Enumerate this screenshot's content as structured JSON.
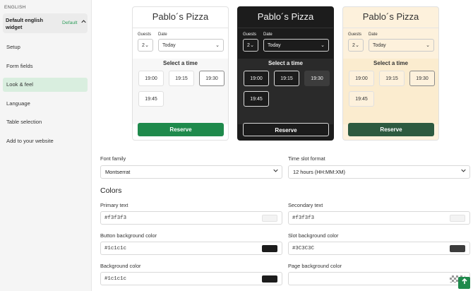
{
  "sidebar": {
    "language_heading": "ENGLISH",
    "widget_name": "Default english widget",
    "widget_badge": "Default",
    "items": [
      {
        "label": "Setup"
      },
      {
        "label": "Form fields"
      },
      {
        "label": "Look & feel"
      },
      {
        "label": "Language"
      },
      {
        "label": "Table selection"
      },
      {
        "label": "Add to your website"
      }
    ],
    "active_item": "Look & feel"
  },
  "previews": [
    {
      "theme": "light",
      "title": "Pablo´s Pizza",
      "guests_label": "Guests",
      "date_label": "Date",
      "guests_value": "2",
      "date_value": "Today",
      "slots_title": "Select a time",
      "slots": [
        "19:00",
        "19:15",
        "19:30",
        "19:45"
      ],
      "selected_slot": "19:30",
      "reserve_label": "Reserve",
      "colors": {
        "bg": "#ffffff",
        "text": "#333333",
        "slot_bg": "#ffffff",
        "button": "#1f8a4c"
      }
    },
    {
      "theme": "dark",
      "title": "Pablo´s Pizza",
      "guests_label": "Guests",
      "date_label": "Date",
      "guests_value": "2",
      "date_value": "Today",
      "slots_title": "Select a time",
      "slots": [
        "19:00",
        "19:15",
        "19:30",
        "19:45"
      ],
      "selected_slot": "19:30",
      "reserve_label": "Reserve",
      "colors": {
        "bg": "#1c1c1c",
        "text": "#f3f3f3",
        "slot_bg": "#1c1c1c",
        "button": "#1c1c1c"
      }
    },
    {
      "theme": "cream",
      "title": "Pablo´s Pizza",
      "guests_label": "Guests",
      "date_label": "Date",
      "guests_value": "2",
      "date_value": "Today",
      "slots_title": "Select a time",
      "slots": [
        "19:00",
        "19:15",
        "19:30",
        "19:45"
      ],
      "selected_slot": "19:30",
      "reserve_label": "Reserve",
      "colors": {
        "bg": "#fdf1dc",
        "text": "#333333",
        "slot_bg": "#fdf1dc",
        "button": "#2d5a40"
      }
    }
  ],
  "settings": {
    "font_family_label": "Font family",
    "font_family_value": "Montserrat",
    "time_format_label": "Time slot format",
    "time_format_value": "12 hours (HH:MM:XM)",
    "colors_heading": "Colors",
    "colors": [
      {
        "label": "Primary text",
        "value": "#f3f3f3",
        "swatch": "#f3f3f3"
      },
      {
        "label": "Secondary text",
        "value": "#f3f3f3",
        "swatch": "#f3f3f3"
      },
      {
        "label": "Button background color",
        "value": "#1c1c1c",
        "swatch": "#1c1c1c"
      },
      {
        "label": "Slot background color",
        "value": "#3C3C3C",
        "swatch": "#3c3c3c"
      },
      {
        "label": "Background color",
        "value": "#1c1c1c",
        "swatch": "#1c1c1c"
      },
      {
        "label": "Page background color",
        "value": "",
        "swatch": "transparent"
      }
    ]
  },
  "fab_icon": "arrow-up-icon"
}
